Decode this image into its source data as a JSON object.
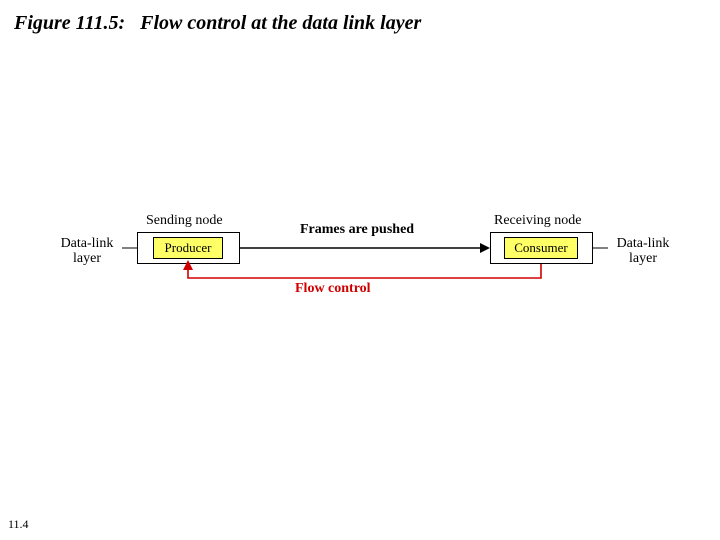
{
  "figure": {
    "number_label": "Figure 111.5:",
    "title_text": "Flow control at the data link layer"
  },
  "diagram": {
    "left_layer_label": "Data-link\nlayer",
    "right_layer_label": "Data-link\nlayer",
    "sending_node_label": "Sending node",
    "receiving_node_label": "Receiving node",
    "producer_label": "Producer",
    "consumer_label": "Consumer",
    "frames_pushed_label": "Frames are pushed",
    "flow_control_label": "Flow control"
  },
  "slide_number": "11.4"
}
